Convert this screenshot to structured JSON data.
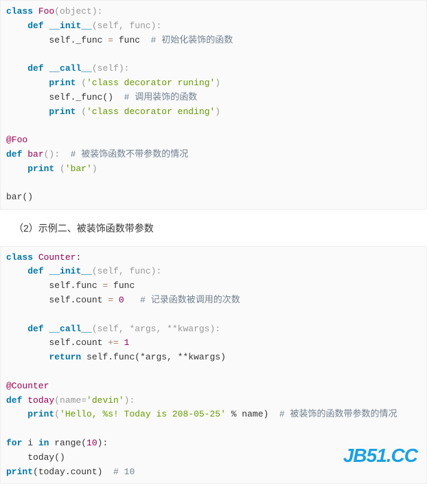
{
  "block1": {
    "l1_kw": "class",
    "l1_cls": "Foo",
    "l1_par": "(object):",
    "l2_i": "    ",
    "l2_kw": "def",
    "l2_sp": " ",
    "l2_fn": "__init__",
    "l2_par": "(self, func):",
    "l3_i": "        ",
    "l3_txt": "self._func ",
    "l3_op": "=",
    "l3_txt2": " func  ",
    "l3_cm": "# 初始化装饰的函数",
    "l4": "",
    "l5_i": "    ",
    "l5_kw": "def",
    "l5_sp": " ",
    "l5_fn": "__call__",
    "l5_par": "(self):",
    "l6_i": "        ",
    "l6_kw": "print",
    "l6_sp": " ",
    "l6_par": "(",
    "l6_str": "'class decorator runing'",
    "l6_par2": ")",
    "l7_i": "        ",
    "l7_txt": "self._func()  ",
    "l7_cm": "# 调用装饰的函数",
    "l8_i": "        ",
    "l8_kw": "print",
    "l8_sp": " ",
    "l8_par": "(",
    "l8_str": "'class decorator ending'",
    "l8_par2": ")",
    "l9": "",
    "l10_dec": "@Foo",
    "l11_kw": "def",
    "l11_sp": " ",
    "l11_fn": "bar",
    "l11_par": "():  ",
    "l11_cm": "# 被装饰函数不带参数的情况",
    "l12_i": "    ",
    "l12_kw": "print",
    "l12_sp": " ",
    "l12_par": "(",
    "l12_str": "'bar'",
    "l12_par2": ")",
    "l13": "",
    "l14_txt": "bar()"
  },
  "prose": {
    "heading": "（2）示例二、被装饰函数带参数"
  },
  "block2": {
    "l1_kw": "class",
    "l1_cls": "Counter",
    "l1_colon": ":",
    "l2_i": "    ",
    "l2_kw": "def",
    "l2_sp": " ",
    "l2_fn": "__init__",
    "l2_par": "(self, func):",
    "l3_i": "        ",
    "l3_txt": "self.func ",
    "l3_op": "=",
    "l3_txt2": " func",
    "l4_i": "        ",
    "l4_txt": "self.count ",
    "l4_op": "=",
    "l4_sp": " ",
    "l4_num": "0",
    "l4_sp2": "   ",
    "l4_cm": "# 记录函数被调用的次数",
    "l5": "",
    "l6_i": "    ",
    "l6_kw": "def",
    "l6_sp": " ",
    "l6_fn": "__call__",
    "l6_par": "(self, *args, **kwargs):",
    "l7_i": "        ",
    "l7_txt": "self.count ",
    "l7_op": "+=",
    "l7_sp": " ",
    "l7_num": "1",
    "l8_i": "        ",
    "l8_kw": "return",
    "l8_txt": " self.func(*args, **kwargs)",
    "l9": "",
    "l10_dec": "@Counter",
    "l11_kw": "def",
    "l11_sp": " ",
    "l11_fn": "today",
    "l11_par": "(name=",
    "l11_str": "'devin'",
    "l11_par2": "):",
    "l12_i": "    ",
    "l12_kw": "print",
    "l12_par": "(",
    "l12_str": "'Hello, %s! Today is 208-05-25'",
    "l12_txt": " % name)  ",
    "l12_cm": "# 被装饰的函数带参数的情况",
    "l13": "",
    "l14_kw": "for",
    "l14_txt": " i ",
    "l14_kw2": "in",
    "l14_txt2": " range(",
    "l14_num": "10",
    "l14_txt3": "):",
    "l15_i": "    ",
    "l15_txt": "today()",
    "l16_kw": "print",
    "l16_txt": "(today.count)  ",
    "l16_cm": "# 10"
  },
  "watermark": "JB51.CC"
}
